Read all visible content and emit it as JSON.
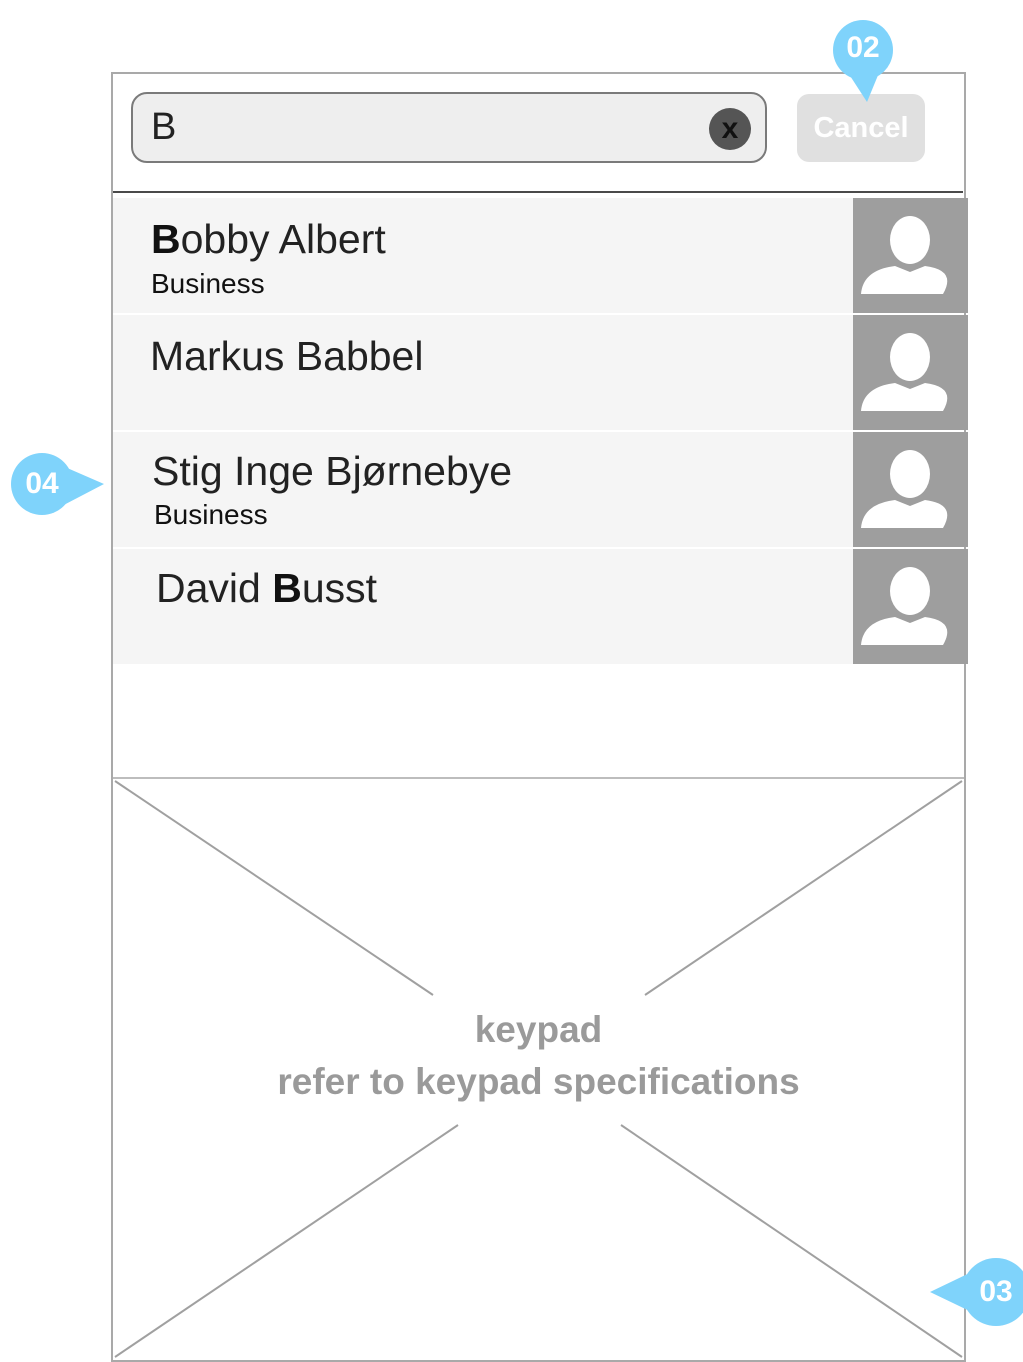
{
  "search": {
    "value": "B"
  },
  "clear_button": {
    "label": "x"
  },
  "cancel_button": {
    "label": "Cancel"
  },
  "contacts": [
    {
      "name_bold": "B",
      "name_rest": "obby Albert",
      "label": "Business"
    },
    {
      "name": "Markus Babbel",
      "label": ""
    },
    {
      "name": "Stig Inge Bjørnebye",
      "label": "Business"
    },
    {
      "name_prefix": "David ",
      "name_bold": "B",
      "name_rest": "usst",
      "label": ""
    }
  ],
  "keypad": {
    "title": "keypad",
    "subtitle": "refer to keypad specifications"
  },
  "markers": {
    "m02": "02",
    "m03": "03",
    "m04": "04"
  },
  "colors": {
    "marker": "#7fd3fb",
    "avatar_bg": "#9e9e9e",
    "row_bg": "#f5f5f5",
    "cancel_bg": "#e0e0e0",
    "keypad_text": "#9a9a9a"
  }
}
